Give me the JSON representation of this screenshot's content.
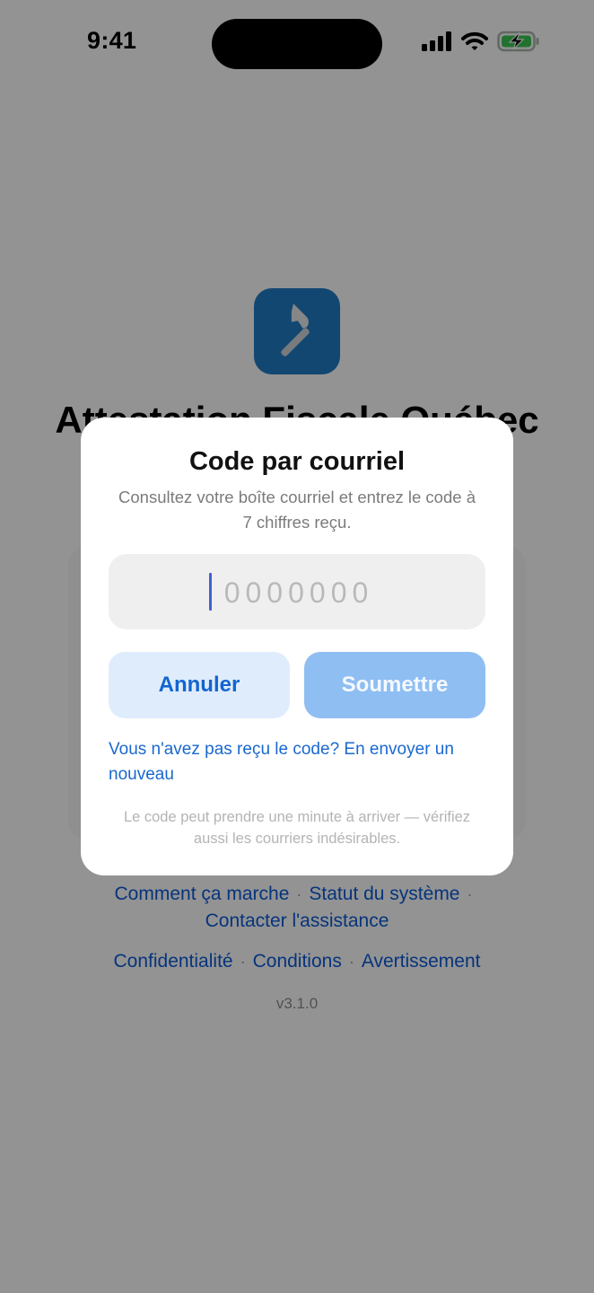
{
  "status_bar": {
    "time": "9:41"
  },
  "app": {
    "title": "Attestation Fiscale Québec",
    "icon": "hammer-icon",
    "accent": "#1f7bc4"
  },
  "footer": {
    "row1": [
      "Comment ça marche",
      "Statut du système"
    ],
    "row2": [
      "Contacter l'assistance"
    ],
    "row3": [
      "Confidentialité",
      "Conditions",
      "Avertissement"
    ],
    "separator": "·"
  },
  "version": "v3.1.0",
  "modal": {
    "title": "Code par courriel",
    "subtitle": "Consultez votre boîte courriel et entrez le code à 7 chiffres reçu.",
    "code_placeholder": "0000000",
    "code_value": "",
    "cancel_label": "Annuler",
    "submit_label": "Soumettre",
    "resend_text": "Vous n'avez pas reçu le code? En envoyer un nouveau",
    "hint": "Le code peut prendre une minute à arriver — vérifiez aussi les courriers indésirables."
  },
  "colors": {
    "link": "#0b5bd6",
    "submit_disabled": "#8fbef2",
    "cancel_bg": "#dfecfc"
  }
}
